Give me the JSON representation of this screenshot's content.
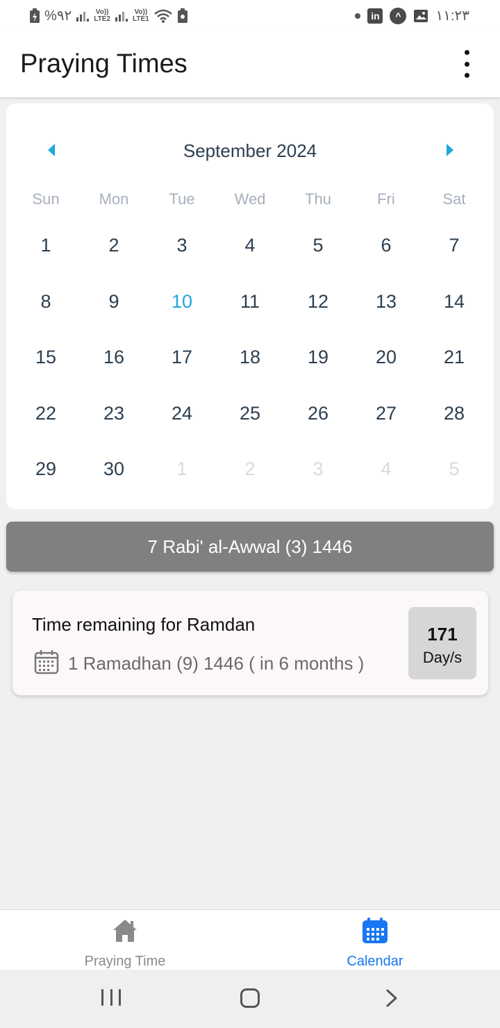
{
  "status_bar": {
    "battery": "%٩٢",
    "lte_2": "LTE2",
    "lte_1": "LTE1",
    "volte": "Vo))",
    "time": "١١:٢٣"
  },
  "app_bar": {
    "title": "Praying Times",
    "menu_icon": "more-vert-icon"
  },
  "calendar": {
    "month_label": "September 2024",
    "prev_icon": "chevron-left-icon",
    "next_icon": "chevron-right-icon",
    "weekdays": [
      "Sun",
      "Mon",
      "Tue",
      "Wed",
      "Thu",
      "Fri",
      "Sat"
    ],
    "days": [
      "1",
      "2",
      "3",
      "4",
      "5",
      "6",
      "7",
      "8",
      "9",
      "10",
      "11",
      "12",
      "13",
      "14",
      "15",
      "16",
      "17",
      "18",
      "19",
      "20",
      "21",
      "22",
      "23",
      "24",
      "25",
      "26",
      "27",
      "28",
      "29",
      "30",
      "1",
      "2",
      "3",
      "4",
      "5"
    ],
    "today": "10",
    "accent_color": "#1fa8dc"
  },
  "hijri_date": "7 Rabi' al-Awwal (3) 1446",
  "ramadan_card": {
    "title": "Time remaining for Ramdan",
    "date": "1 Ramadhan (9) 1446 ( in 6 months )",
    "days_count": "171",
    "days_unit": "Day/s"
  },
  "bottom_nav": {
    "items": [
      {
        "label": "Praying Time",
        "icon": "home-icon",
        "active": false
      },
      {
        "label": "Calendar",
        "icon": "calendar-icon",
        "active": true
      }
    ],
    "active_color": "#1877f2"
  }
}
